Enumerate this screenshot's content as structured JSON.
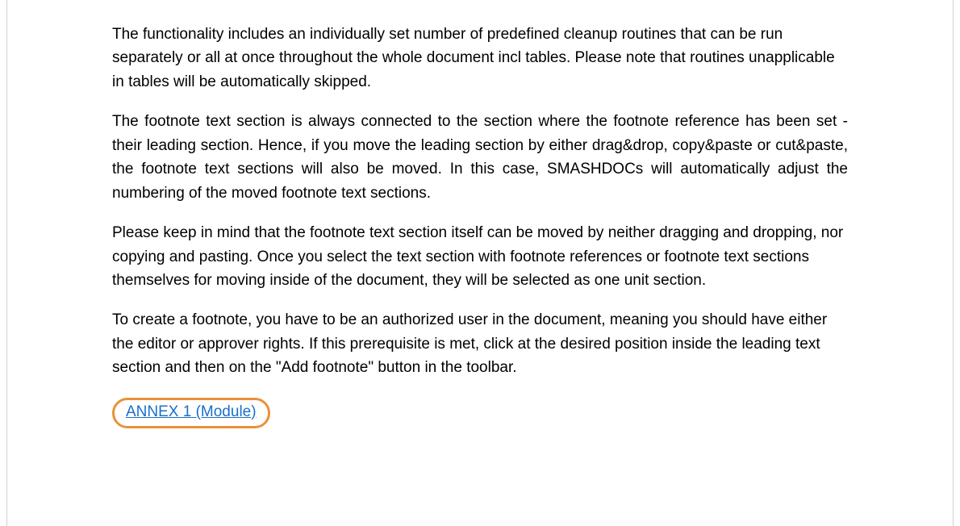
{
  "paragraphs": {
    "p1": "The functionality includes an individually set number of predefined cleanup routines that can be run separately or all at once throughout the whole document incl tables. Please note that routines unapplicable in tables will be automatically skipped.",
    "p2": "The footnote text section is always connected to the section where the footnote reference has been set - their leading section. Hence, if you move the leading section by either drag&drop, copy&paste or cut&paste, the footnote text sections will also be moved. In this case, SMASHDOCs will automatically adjust the numbering of the moved footnote text sections.",
    "p3": "Please keep in mind that the footnote text section itself can be moved by neither dragging and dropping, nor copying and pasting. Once you select the text section with footnote references or footnote text sections themselves for moving inside of the document, they will be selected as one unit section.",
    "p4": "To create a footnote, you have to be an authorized user in the document, meaning you should have either the editor or approver rights. If this prerequisite is met, click at the desired position inside the leading text section and then on the \"Add footnote\" button in the toolbar."
  },
  "link": {
    "label": "ANNEX 1 (Module)"
  }
}
